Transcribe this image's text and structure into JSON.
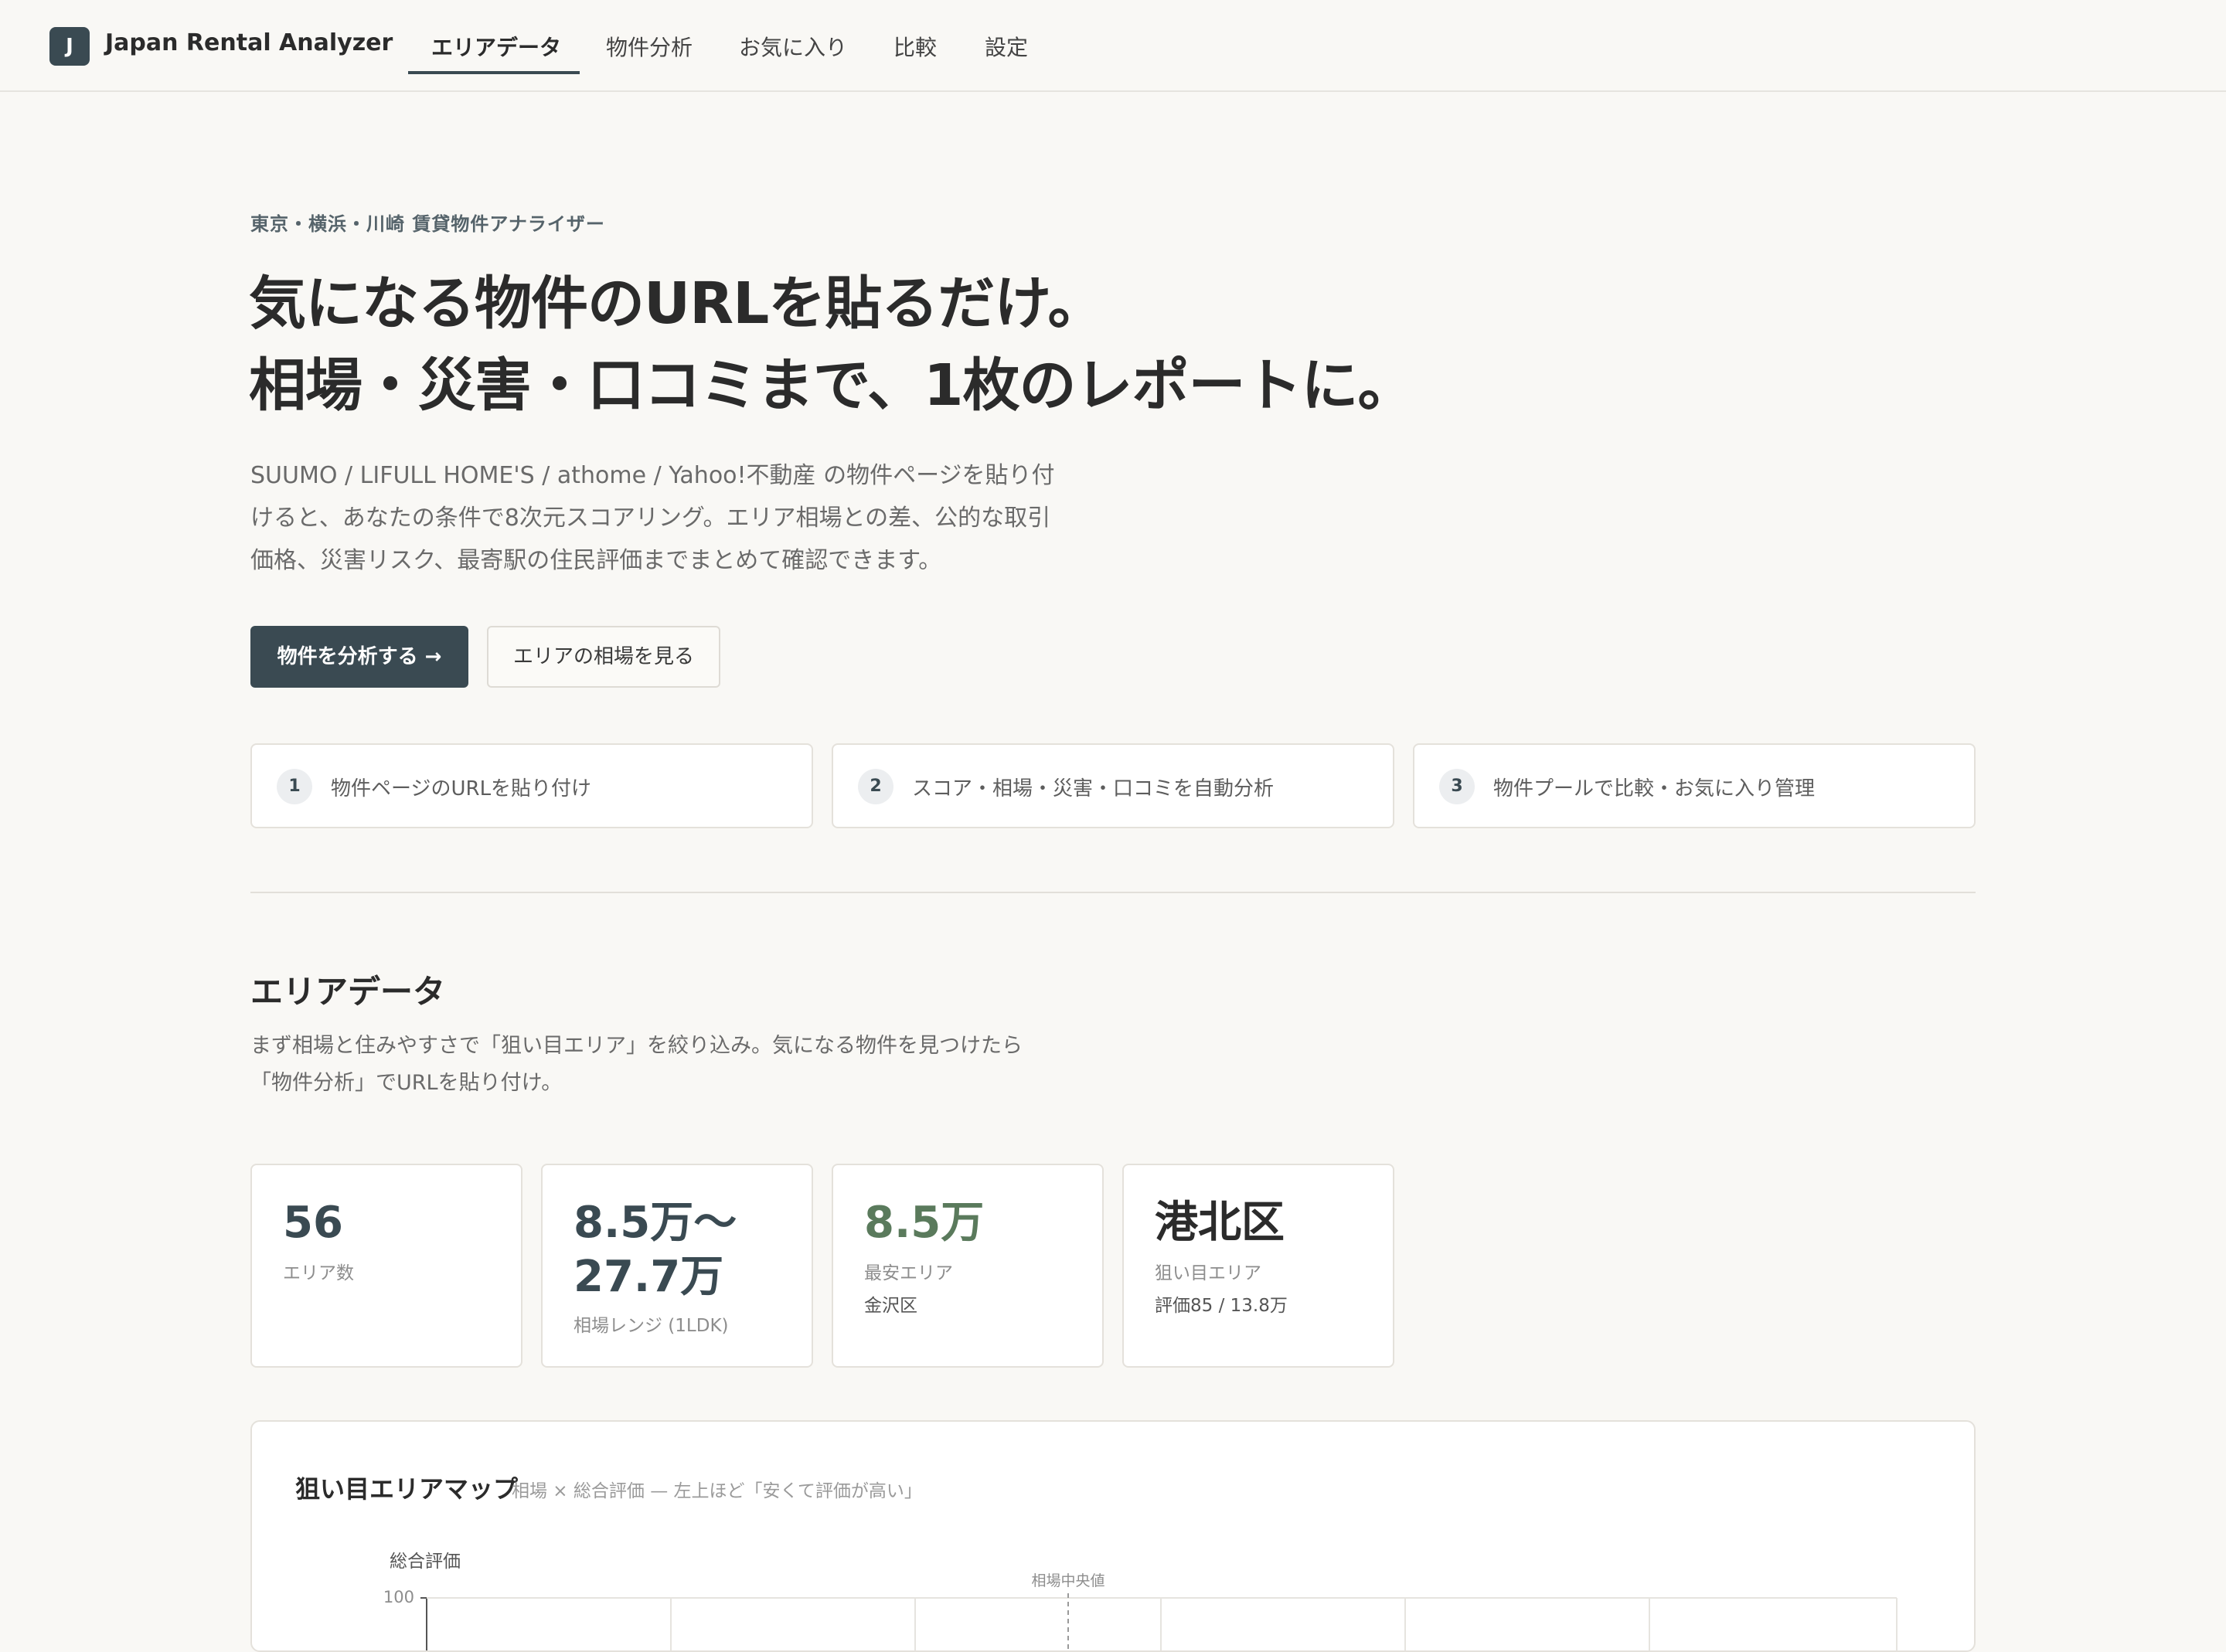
{
  "app": {
    "logo_letter": "J",
    "title": "Japan Rental Analyzer"
  },
  "nav": {
    "items": [
      {
        "label": "エリアデータ",
        "active": true
      },
      {
        "label": "物件分析",
        "active": false
      },
      {
        "label": "お気に入り",
        "active": false
      },
      {
        "label": "比較",
        "active": false
      },
      {
        "label": "設定",
        "active": false
      }
    ]
  },
  "hero": {
    "eyebrow": "東京・横浜・川崎 賃貸物件アナライザー",
    "title_line1": "気になる物件のURLを貼るだけ。",
    "title_line2": "相場・災害・口コミまで、1枚のレポートに。",
    "description": "SUUMO / LIFULL HOME'S / athome / Yahoo!不動産 の物件ページを貼り付けると、あなたの条件で8次元スコアリング。エリア相場との差、公的な取引価格、災害リスク、最寄駅の住民評価までまとめて確認できます。",
    "primary_button": "物件を分析する →",
    "secondary_button": "エリアの相場を見る"
  },
  "steps": [
    {
      "num": "1",
      "label": "物件ページのURLを貼り付け"
    },
    {
      "num": "2",
      "label": "スコア・相場・災害・口コミを自動分析"
    },
    {
      "num": "3",
      "label": "物件プールで比較・お気に入り管理"
    }
  ],
  "area_section": {
    "title": "エリアデータ",
    "description": "まず相場と住みやすさで「狙い目エリア」を絞り込み。気になる物件を見つけたら「物件分析」でURLを貼り付け。"
  },
  "stats": [
    {
      "value": "56",
      "label": "エリア数",
      "sub": ""
    },
    {
      "value": "8.5万〜27.7万",
      "label": "相場レンジ (1LDK)",
      "sub": ""
    },
    {
      "value": "8.5万",
      "label": "最安エリア",
      "sub": "金沢区"
    },
    {
      "value": "港北区",
      "label": "狙い目エリア",
      "sub": "評価85 / 13.8万"
    }
  ],
  "colors": {
    "accent": "#3a4a52",
    "green": "#5a7a5c",
    "background": "#f9f8f5"
  },
  "map": {
    "title": "狙い目エリアマップ",
    "subtitle": "相場 × 総合評価 — 左上ほど「安くて評価が高い」",
    "y_axis_label": "総合評価",
    "median_label": "相場中央値",
    "y_top_tick": "100"
  }
}
